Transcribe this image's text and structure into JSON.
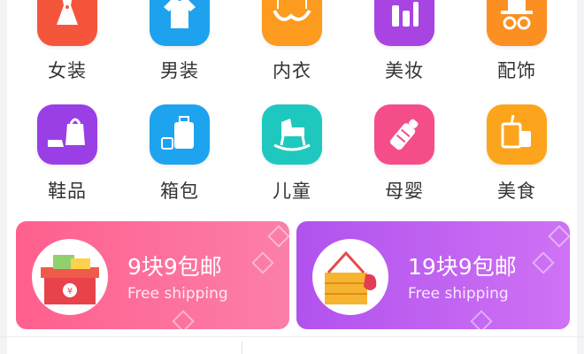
{
  "categories_row1": [
    {
      "label": "女装",
      "icon": "dress-icon",
      "color": "#f5563b"
    },
    {
      "label": "男装",
      "icon": "shirt-icon",
      "color": "#1ea2ee"
    },
    {
      "label": "内衣",
      "icon": "bra-icon",
      "color": "#fc9b1d"
    },
    {
      "label": "美妆",
      "icon": "cosmetics-icon",
      "color": "#a744e2"
    },
    {
      "label": "配饰",
      "icon": "hat-glasses-icon",
      "color": "#fb8f22"
    }
  ],
  "categories_row2": [
    {
      "label": "鞋品",
      "icon": "shoe-bag-icon",
      "color": "#9a3fe6"
    },
    {
      "label": "箱包",
      "icon": "suitcase-icon",
      "color": "#1ea3ef"
    },
    {
      "label": "儿童",
      "icon": "rocking-horse-icon",
      "color": "#1fc8be"
    },
    {
      "label": "母婴",
      "icon": "baby-bottle-icon",
      "color": "#f54d8a"
    },
    {
      "label": "美食",
      "icon": "drink-icon",
      "color": "#fca51c"
    }
  ],
  "promos": [
    {
      "title": "9块9包邮",
      "subtitle": "Free shipping",
      "icon": "gift-box-icon",
      "gradient_from": "#ff5f8d",
      "gradient_to": "#fb7fa9"
    },
    {
      "title": "19块9包邮",
      "subtitle": "Free shipping",
      "icon": "gift-basket-icon",
      "gradient_from": "#b152ee",
      "gradient_to": "#cf72f4"
    }
  ]
}
